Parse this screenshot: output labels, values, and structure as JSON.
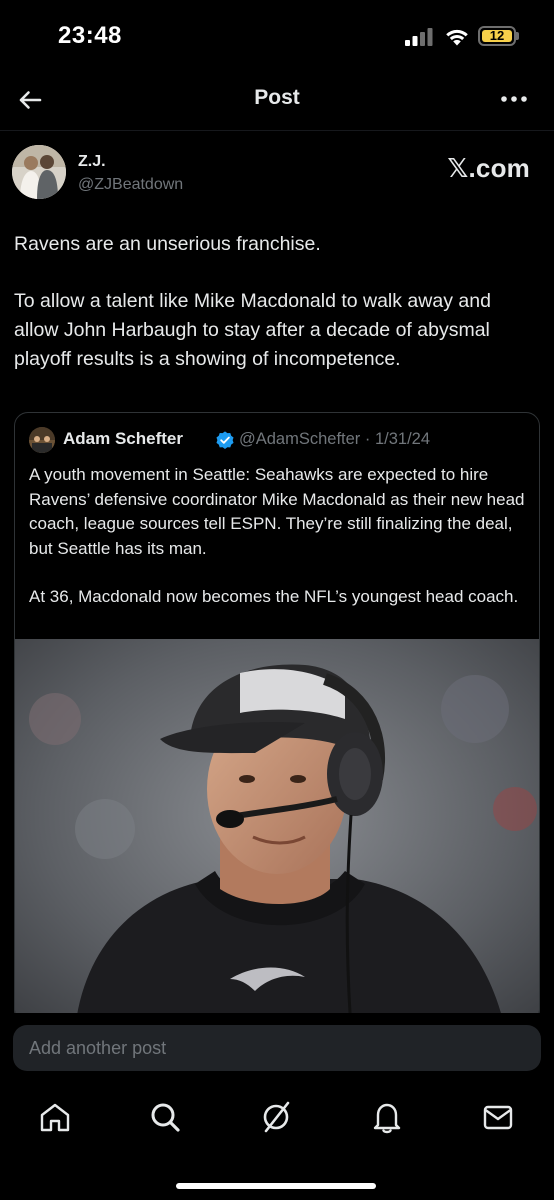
{
  "status_bar": {
    "time": "23:48",
    "battery_level": "12"
  },
  "nav": {
    "title": "Post",
    "back_icon": "back-arrow-icon",
    "more_icon": "more-dots-icon"
  },
  "post": {
    "author_name": "Z.J.",
    "author_handle": "@ZJBeatdown",
    "source_brand": "𝕏.com",
    "paragraphs": [
      "Ravens are an unserious franchise.",
      "To allow a talent like Mike Macdonald to walk away and allow John Harbaugh to stay after a decade of abysmal playoff results is a showing of incompetence."
    ]
  },
  "quote": {
    "author_name": "Adam Schefter",
    "verified": true,
    "handle_date": "@AdamSchefter · 1/31/24",
    "paragraphs": [
      "A youth movement in Seattle: Seahawks are expected to hire Ravens’ defensive coordinator Mike Macdonald as their new head coach, league sources tell ESPN. They’re still finalizing the deal, but Seattle has its man.",
      "At 36, Macdonald now becomes the NFL’s youngest head coach."
    ]
  },
  "reply": {
    "placeholder": "Add another post"
  },
  "tabbar": {
    "items": [
      "home-icon",
      "search-icon",
      "grok-icon",
      "notifications-icon",
      "messages-icon"
    ]
  },
  "colors": {
    "background": "#000000",
    "text": "#e7e9ea",
    "secondary": "#71767b",
    "verified": "#1d9bf0",
    "battery": "#f7d04a"
  }
}
